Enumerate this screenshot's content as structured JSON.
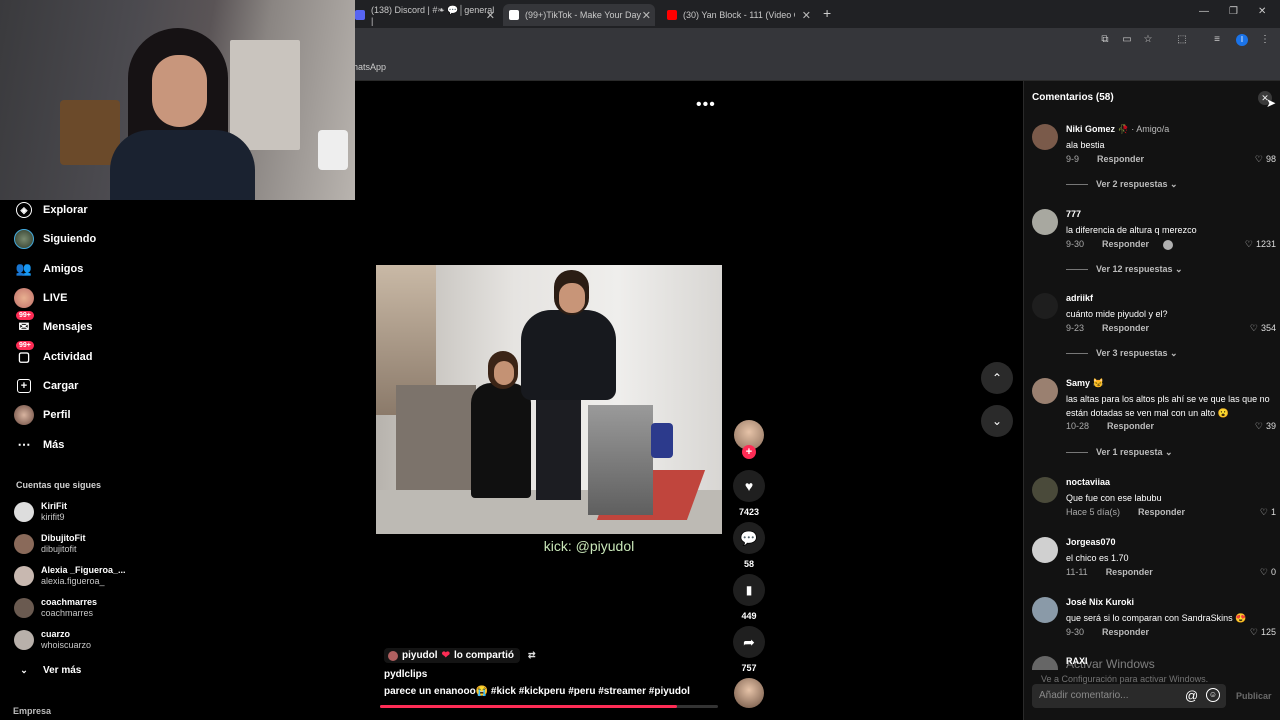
{
  "browser": {
    "tabs": [
      {
        "label": "(138) Discord | #❧ 💬│general |",
        "fav": "#5865f2"
      },
      {
        "label": "(99+)TikTok - Make Your Day",
        "fav": "#ffffff"
      },
      {
        "label": "(30) Yan Block - 111 (Video Ofi",
        "fav": "#ff0000"
      }
    ],
    "new_tab": "+",
    "bookmark": "hatsApp"
  },
  "video": {
    "overlay_text": "kick: @piyudol",
    "more": "•••",
    "author": "piyudol",
    "shared": "lo compartió",
    "username": "pydlclips",
    "caption": "parece un enanooo😭 #kick #kickperu #peru #streamer #piyudol",
    "progress": 0.88
  },
  "sidebar": {
    "items": [
      {
        "label": "Explorar",
        "icon": "compass-icon"
      },
      {
        "label": "Siguiendo",
        "icon": "following-avatar"
      },
      {
        "label": "Amigos",
        "icon": "friends-icon"
      },
      {
        "label": "LIVE",
        "icon": "live-avatar"
      },
      {
        "label": "Mensajes",
        "icon": "messages-icon",
        "badge": "99+"
      },
      {
        "label": "Actividad",
        "icon": "activity-icon",
        "badge": "99+"
      },
      {
        "label": "Cargar",
        "icon": "upload-icon"
      },
      {
        "label": "Perfil",
        "icon": "profile-avatar"
      },
      {
        "label": "Más",
        "icon": "more-icon"
      }
    ],
    "following_title": "Cuentas que sigues",
    "following": [
      {
        "name": "KiriFit",
        "handle": "kirifit9"
      },
      {
        "name": "DibujitoFit",
        "handle": "dibujitofit"
      },
      {
        "name": "Alexia _Figueroa_...",
        "handle": "alexia.figueroa_"
      },
      {
        "name": "coachmarres",
        "handle": "coachmarres"
      },
      {
        "name": "cuarzo",
        "handle": "whoiscuarzo"
      }
    ],
    "see_more": "Ver más",
    "footer": "Empresa"
  },
  "actions": {
    "likes": "7423",
    "comments": "58",
    "saves": "449",
    "shares": "757",
    "follow_plus": "+"
  },
  "comments": {
    "title": "Comentarios (58)",
    "close": "✕",
    "reply_label": "Responder",
    "items": [
      {
        "user": "Niki Gomez 🥀",
        "tag": " · Amigo/a",
        "text": "ala bestia",
        "date": "9-9",
        "likes": "98",
        "replies": "Ver 2 respuestas ⌄",
        "av": "#7a5a4a"
      },
      {
        "user": "777",
        "tag": "",
        "text": "la diferencia de altura q merezco",
        "date": "9-30",
        "likes": "1231",
        "replies": "Ver 12 respuestas ⌄",
        "av": "#a8a8a0"
      },
      {
        "user": "adriikf",
        "tag": "",
        "text": "cuánto mide piyudol y el?",
        "date": "9-23",
        "likes": "354",
        "replies": "Ver 3 respuestas ⌄",
        "av": "#1e1e1e"
      },
      {
        "user": "Samy 😼",
        "tag": "",
        "text": "las altas para los altos pls ahí se ve que las que no están dotadas se ven mal con un alto 😮",
        "date": "10-28",
        "likes": "39",
        "replies": "Ver 1 respuesta ⌄",
        "av": "#9a8070"
      },
      {
        "user": "noctaviiaa",
        "tag": "",
        "text": "Que fue con ese labubu",
        "date": "Hace 5 día(s)",
        "likes": "1",
        "replies": "",
        "av": "#4a4a3a"
      },
      {
        "user": "Jorgeas070",
        "tag": "",
        "text": "el chico es 1.70",
        "date": "11-11",
        "likes": "0",
        "replies": "",
        "av": "#d0d0d0"
      },
      {
        "user": "José Nix Kuroki",
        "tag": "",
        "text": "que será si lo comparan con SandraSkins 😍",
        "date": "9-30",
        "likes": "125",
        "replies": "",
        "av": "#8a9aa8"
      },
      {
        "user": "RAXI",
        "tag": "",
        "text": "",
        "date": "",
        "likes": "",
        "replies": "",
        "av": "#666"
      }
    ],
    "input_placeholder": "Añadir comentario...",
    "publish": "Publicar"
  },
  "watermark": {
    "line1": "Activar Windows",
    "line2": "Ve a Configuración para activar Windows."
  },
  "colors": {
    "accent": "#fe2c55",
    "panel": "#121212"
  }
}
